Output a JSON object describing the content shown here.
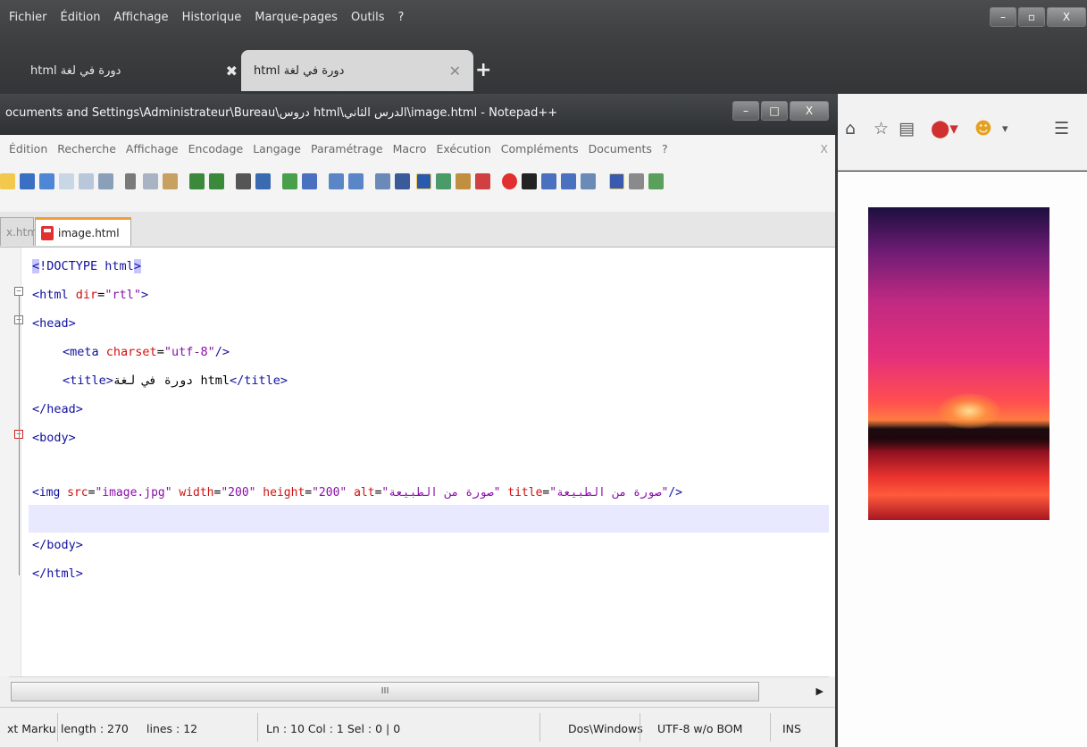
{
  "firefox": {
    "menu": [
      "Fichier",
      "Édition",
      "Affichage",
      "Historique",
      "Marque-pages",
      "Outils",
      "?"
    ],
    "window_buttons": [
      "–",
      "▫",
      "X"
    ],
    "tabs": [
      {
        "label": "html دورة في لغة",
        "close": "✖"
      },
      {
        "label": "html دورة في لغة",
        "close": "✕"
      }
    ],
    "new_tab": "+",
    "toolbar_icons": [
      "home-icon",
      "bookmark-star-icon",
      "reading-list-icon",
      "adblock-icon",
      "greasemonkey-icon",
      "menu-icon"
    ],
    "image": {
      "alt": "صورة من الطبيعة"
    }
  },
  "notepad": {
    "title": "ocuments and Settings\\Administrateur\\Bureau\\دروس html\\الدرس الثاني\\image.html - Notepad++",
    "window_buttons": [
      "–",
      "□",
      "X"
    ],
    "menu": [
      "Édition",
      "Recherche",
      "Affichage",
      "Encodage",
      "Langage",
      "Paramétrage",
      "Macro",
      "Exécution",
      "Compléments",
      "Documents",
      "?"
    ],
    "menu_close": "X",
    "tabs": [
      {
        "label": "x.html"
      },
      {
        "label": "image.html"
      }
    ],
    "code": {
      "l1a": "<",
      "l1b": "!DOCTYPE html",
      "l1c": ">",
      "l2a": "<html ",
      "l2b": "dir",
      "l2c": "=",
      "l2d": "\"rtl\"",
      "l2e": ">",
      "l3": "<head>",
      "l4a": "<meta ",
      "l4b": "charset",
      "l4c": "=",
      "l4d": "\"utf-8\"",
      "l4e": "/>",
      "l5a": "<title>",
      "l5b": "دورة في لغة html",
      "l5c": "</title>",
      "l6": "</head>",
      "l7": "<body>",
      "l8a": "<img ",
      "l8b": "src",
      "l8c": "=",
      "l8d": "\"image.jpg\"",
      "l8e": " width",
      "l8f": "=",
      "l8g": "\"200\"",
      "l8h": " height",
      "l8i": "=",
      "l8j": "\"200\"",
      "l8k": " alt",
      "l8l": "=",
      "l8m": "\"صورة من الطبيعة\"",
      "l8n": " title",
      "l8o": "=",
      "l8p": "\"صورة من الطبيعة\"",
      "l8q": "/>",
      "l10": "</body>",
      "l11": "</html>"
    },
    "scroll_grip": "III",
    "status": {
      "type": "xt Marku",
      "length": "length : 270",
      "lines": "lines : 12",
      "pos": "Ln : 10   Col : 1   Sel : 0 | 0",
      "eol": "Dos\\Windows",
      "encoding": "UTF-8 w/o BOM",
      "mode": "INS"
    }
  }
}
